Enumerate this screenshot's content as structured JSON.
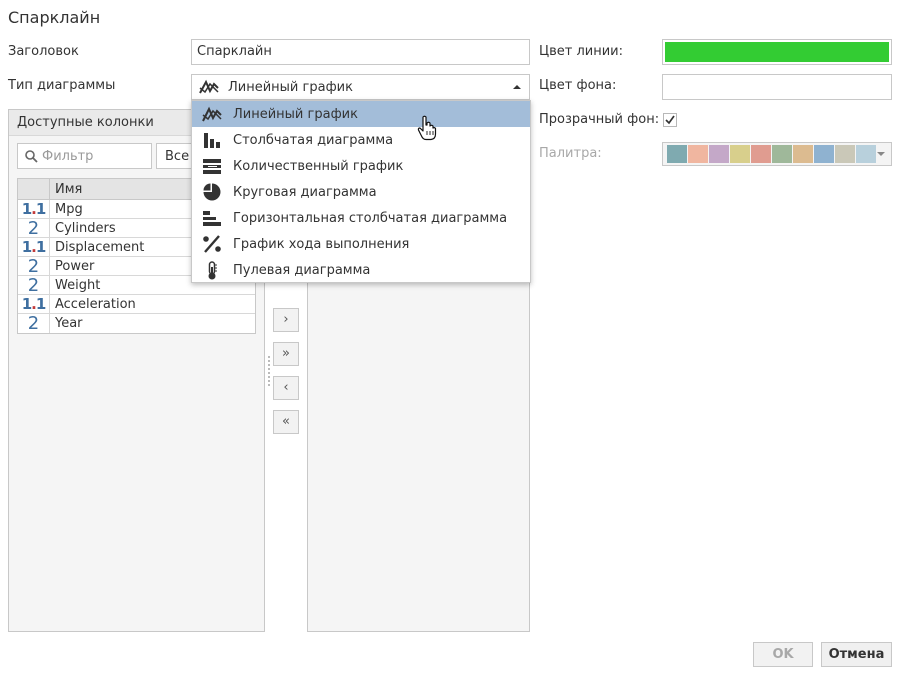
{
  "dialog": {
    "title": "Спарклайн"
  },
  "form": {
    "title_label": "Заголовок",
    "title_value": "Спарклайн",
    "chart_type_label": "Тип диаграммы",
    "chart_type_value": "Линейный график",
    "line_color_label": "Цвет линии:",
    "line_color": "#33cc33",
    "bg_color_label": "Цвет фона:",
    "bg_color": "#ffffff",
    "transparent_label": "Прозрачный фон:",
    "transparent_checked": true,
    "palette_label": "Палитра:",
    "palette_colors": [
      "#7faab0",
      "#f0b6a0",
      "#c4a8c8",
      "#d8cf8c",
      "#e09c90",
      "#9fb89a",
      "#dcbb90",
      "#8fb2d0",
      "#cac8b8",
      "#b8d0dc"
    ]
  },
  "available": {
    "header": "Доступные колонки",
    "filter_placeholder": "Фильтр",
    "type_filter": "Все т",
    "column_header": "Имя",
    "rows": [
      {
        "type": "1.1",
        "name": "Mpg"
      },
      {
        "type": "2",
        "name": "Cylinders"
      },
      {
        "type": "1.1",
        "name": "Displacement"
      },
      {
        "type": "2",
        "name": "Power"
      },
      {
        "type": "2",
        "name": "Weight"
      },
      {
        "type": "1.1",
        "name": "Acceleration"
      },
      {
        "type": "2",
        "name": "Year"
      }
    ]
  },
  "move_buttons": {
    "add": "›",
    "add_all": "»",
    "remove": "‹",
    "remove_all": "«"
  },
  "dropdown": {
    "items": [
      {
        "icon": "line-chart-icon",
        "label": "Линейный график"
      },
      {
        "icon": "bar-chart-icon",
        "label": "Столбчатая диаграмма"
      },
      {
        "icon": "bullet-chart-icon",
        "label": "Количественный график"
      },
      {
        "icon": "pie-chart-icon",
        "label": "Круговая диаграмма"
      },
      {
        "icon": "horizontal-bar-chart-icon",
        "label": "Горизонтальная столбчатая диаграмма"
      },
      {
        "icon": "percent-icon",
        "label": "График хода выполнения"
      },
      {
        "icon": "thermometer-icon",
        "label": "Пулевая диаграмма"
      }
    ]
  },
  "buttons": {
    "ok": "OK",
    "cancel": "Отмена"
  }
}
